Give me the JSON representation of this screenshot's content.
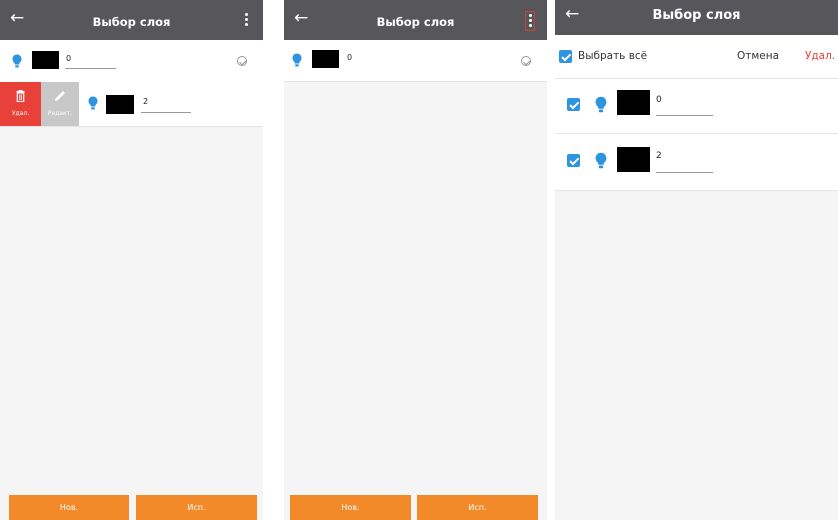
{
  "colors": {
    "appbar": "#57575b",
    "accent_orange": "#f28a2a",
    "delete_red": "#e8413a",
    "bulb_blue": "#2f94e0"
  },
  "screen1": {
    "title": "Выбор слоя",
    "rows": [
      {
        "value": "0"
      },
      {
        "value": "2"
      }
    ],
    "swipe_actions": {
      "delete_label": "Удал.",
      "edit_label": "Редакт."
    },
    "footer": {
      "new_label": "Нов.",
      "use_label": "Исп."
    }
  },
  "screen2": {
    "title": "Выбор слоя",
    "rows": [
      {
        "value": "0"
      }
    ],
    "footer": {
      "new_label": "Нов.",
      "use_label": "Исп."
    }
  },
  "screen3": {
    "title": "Выбор слоя",
    "select_all_label": "Выбрать всё",
    "cancel_label": "Отмена",
    "delete_label": "Удал.",
    "rows": [
      {
        "value": "0",
        "checked": true
      },
      {
        "value": "2",
        "checked": true
      }
    ]
  }
}
